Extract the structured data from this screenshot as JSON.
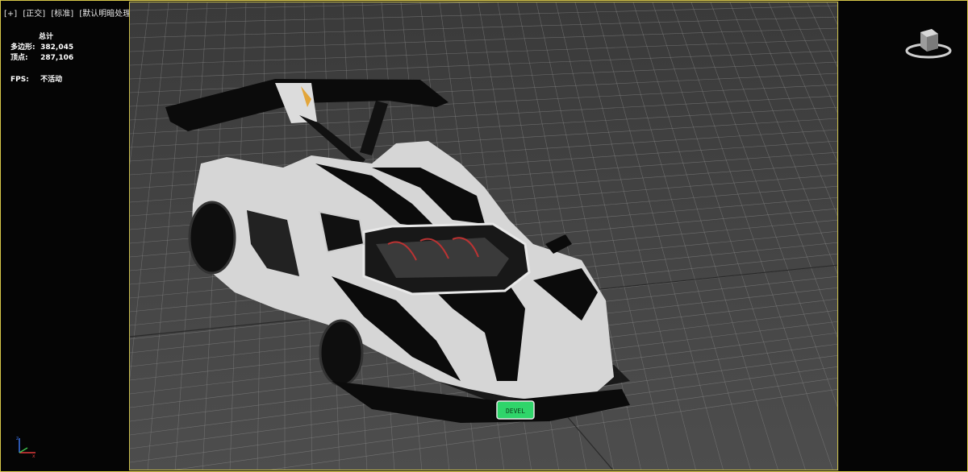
{
  "viewport": {
    "labels": [
      "[+]",
      "[正交]",
      "[标准]",
      "[默认明暗处理]"
    ]
  },
  "stats": {
    "title": "总计",
    "polygons_label": "多边形:",
    "polygons_value": "382,045",
    "vertices_label": "顶点:",
    "vertices_value": "287,106",
    "fps_label": "FPS:",
    "fps_value": "不活动"
  },
  "license_plate": "DEVEL",
  "colors": {
    "frame_border": "#d9c94a",
    "side_panel": "#050505",
    "viewport_bg": "#444444",
    "grid_line": "#8a8a8a",
    "car_body": "#d6d6d6",
    "car_accent": "#0b0b0b",
    "plate_green": "#2fd56a"
  },
  "icons": [
    "viewport-filter-icon",
    "viewcube-icon",
    "axis-gizmo-icon"
  ]
}
